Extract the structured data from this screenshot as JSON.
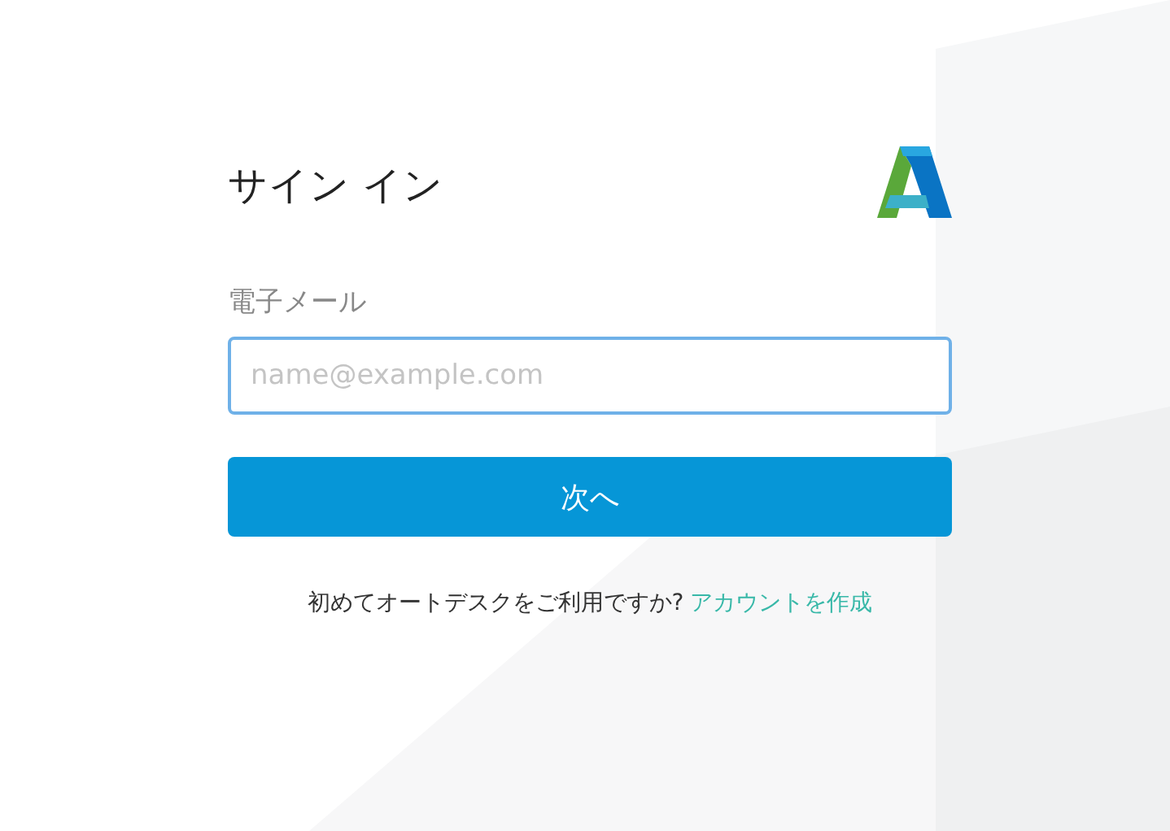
{
  "title": "サイン イン",
  "email": {
    "label": "電子メール",
    "placeholder": "name@example.com"
  },
  "next_button": "次へ",
  "signup": {
    "prompt": "初めてオートデスクをご利用ですか?",
    "link": "アカウントを作成"
  }
}
